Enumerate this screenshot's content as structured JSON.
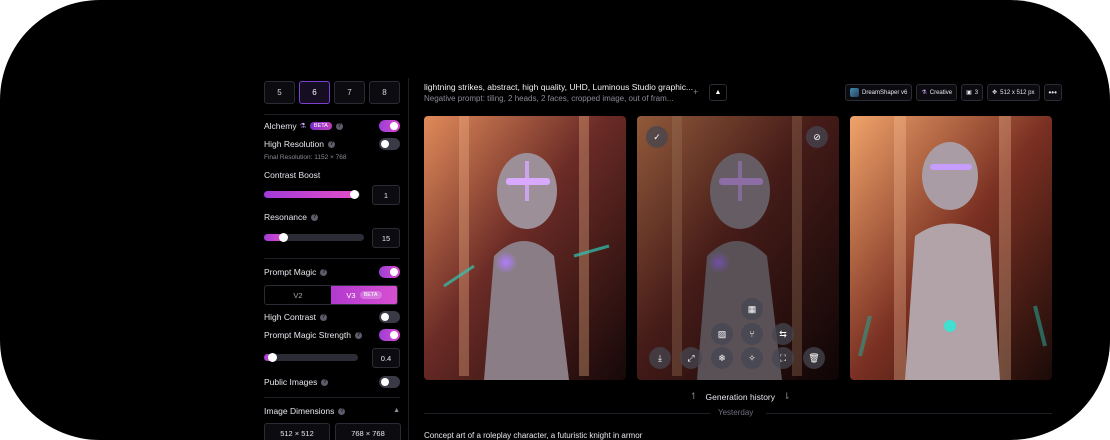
{
  "quantity": {
    "options": [
      "5",
      "6",
      "7",
      "8"
    ],
    "selected": "6"
  },
  "alchemy": {
    "label": "Alchemy",
    "badge": "BETA",
    "enabled": true
  },
  "high_resolution": {
    "label": "High Resolution",
    "enabled": false,
    "final_resolution": "Final Resolution: 1152 × 768"
  },
  "contrast_boost": {
    "label": "Contrast Boost",
    "value": "1",
    "fraction": 0.95
  },
  "resonance": {
    "label": "Resonance",
    "value": "15",
    "fraction": 0.2
  },
  "prompt_magic": {
    "label": "Prompt Magic",
    "enabled": true,
    "v2": "V2",
    "v3": "V3",
    "v3_badge": "BETA"
  },
  "high_contrast": {
    "label": "High Contrast",
    "enabled": false
  },
  "prompt_magic_strength": {
    "label": "Prompt Magic Strength",
    "enabled": true,
    "value": "0.4",
    "fraction": 0.1
  },
  "public_images": {
    "label": "Public Images",
    "enabled": false
  },
  "image_dimensions": {
    "label": "Image Dimensions",
    "options": [
      "512 × 512",
      "768 × 768"
    ]
  },
  "generation": {
    "prompt": "lightning strikes, abstract, high quality, UHD, Luminous Studio graphic...",
    "negative_prompt": "Negative prompt: tiling, 2 heads, 2 faces, cropped image, out of fram...",
    "model": "DreamShaper v6",
    "style": "Creative",
    "count": "3",
    "size": "512 x 512 px"
  },
  "history": {
    "label": "Generation history",
    "yesterday": "Yesterday"
  },
  "next_prompt": "Concept art of a roleplay character, a futuristic knight in armor",
  "colors": {
    "accent": "#c13ebd",
    "accent2": "#9b3fd6",
    "background": "#000000"
  }
}
